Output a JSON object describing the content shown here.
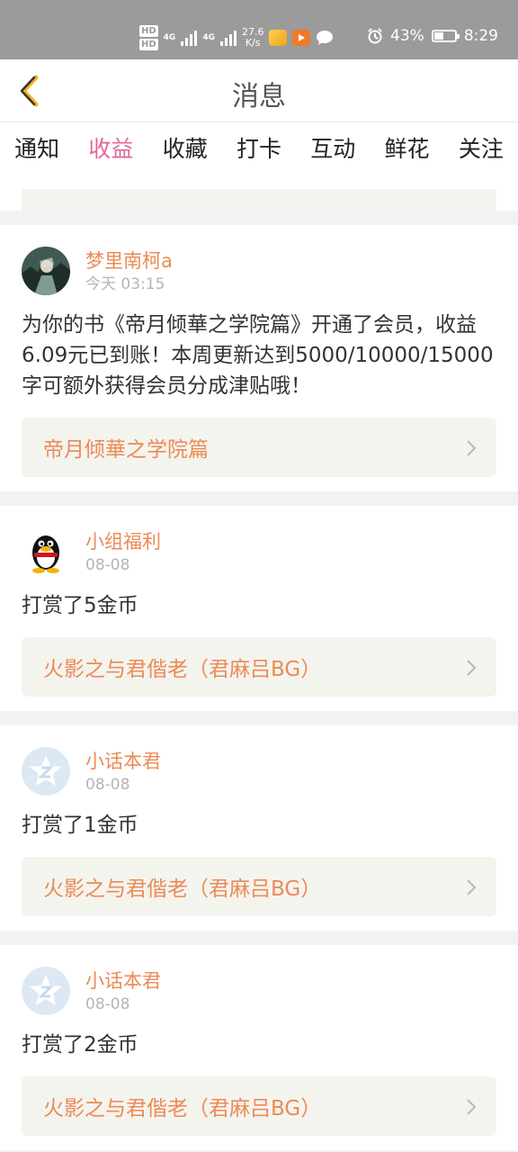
{
  "status_bar": {
    "hd1": "HD",
    "hd2": "HD",
    "net1": "4G",
    "net2": "4G",
    "speed_value": "27.6",
    "speed_unit": "K/s",
    "battery_percent": "43%",
    "battery_level": 0.43,
    "time": "8:29",
    "icons": [
      "alarm-icon",
      "battery-icon",
      "signal-icon",
      "app-icon",
      "video-app-icon",
      "chat-bubble-icon"
    ]
  },
  "header": {
    "title": "消息",
    "back_icon": "chevron-left-icon"
  },
  "tabs": [
    {
      "label": "通知",
      "active": false
    },
    {
      "label": "收益",
      "active": true
    },
    {
      "label": "收藏",
      "active": false
    },
    {
      "label": "打卡",
      "active": false
    },
    {
      "label": "互动",
      "active": false
    },
    {
      "label": "鲜花",
      "active": false
    },
    {
      "label": "关注",
      "active": false
    }
  ],
  "messages": [
    {
      "username": "梦里南柯a",
      "time": "今天 03:15",
      "text": "为你的书《帝月倾華之学院篇》开通了会员，收益6.09元已到账！本周更新达到5000/10000/15000字可额外获得会员分成津贴哦！",
      "link": "帝月倾華之学院篇",
      "avatar": "illustrated-avatar"
    },
    {
      "username": "小组福利",
      "time": "08-08",
      "text": "打赏了5金币",
      "link": "火影之与君偕老（君麻吕BG）",
      "avatar": "penguin-avatar"
    },
    {
      "username": "小话本君",
      "time": "08-08",
      "text": "打赏了1金币",
      "link": "火影之与君偕老（君麻吕BG）",
      "avatar": "default-star-avatar"
    },
    {
      "username": "小话本君",
      "time": "08-08",
      "text": "打赏了2金币",
      "link": "火影之与君偕老（君麻吕BG）",
      "avatar": "default-star-avatar"
    }
  ],
  "colors": {
    "accent_pink": "#e0679a",
    "orange_text": "#ec8a56",
    "status_bar_bg": "#9b9b9b",
    "link_box_bg": "#f4f4ee"
  }
}
